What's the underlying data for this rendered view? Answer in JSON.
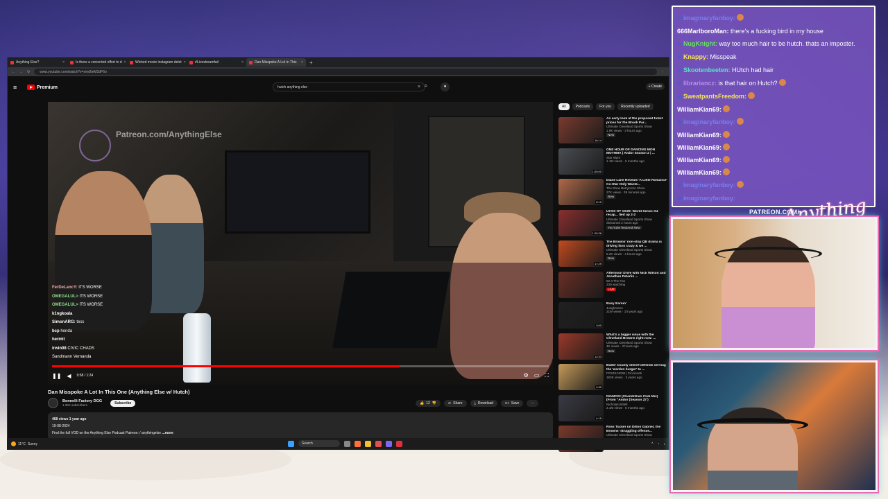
{
  "browser": {
    "tabs": [
      {
        "label": "Anything Else?",
        "active": false
      },
      {
        "label": "Is there a concerted effort to d",
        "active": false
      },
      {
        "label": "Wicked movie instagram delet",
        "active": false
      },
      {
        "label": "r/Livestreamfail",
        "active": false
      },
      {
        "label": "Dan Misspoke A Lot In This",
        "active": true
      }
    ],
    "url": "www.youtube.com/watch?v=xmd0eM3dF6o"
  },
  "youtube": {
    "logo": "Premium",
    "search_value": "hutch anything else",
    "create_label": "+ Create",
    "video": {
      "watermark": "Patreon.com/AnythingElse",
      "overlay_chat": [
        {
          "user": "FerDeLancY:",
          "msg": "ITS WORSE",
          "color": "#f0a8a8"
        },
        {
          "user": "OMEGALUL>",
          "msg": "ITS WORSE",
          "color": "#8fe08f"
        },
        {
          "user": "OMEGALUL>",
          "msg": "ITS WORSE",
          "color": "#8fe08f"
        },
        {
          "user": "k1ngkoala",
          "msg": "",
          "color": "#ffffff"
        },
        {
          "user": "SimonARG:",
          "msg": "tess",
          "color": "#ffffff"
        },
        {
          "user": "bcp",
          "msg": "honda",
          "color": "#ffffff"
        },
        {
          "user": "hermit",
          "msg": "",
          "color": "#ffffff"
        },
        {
          "user": "irwin08",
          "msg": "CIVIC CHADS",
          "color": "#ffffff"
        },
        {
          "user": "",
          "msg": "Sandmann Vernanda",
          "color": "#ffffff"
        }
      ],
      "time": "0:58 / 1:24",
      "progress": 0.7,
      "title": "Dan Misspoke A Lot In This One (Anything Else w/ Hutch)"
    },
    "channel": {
      "name": "Bonnelli Factory DGG",
      "subs": "1.36K subscribers",
      "subscribe_label": "Subscribe"
    },
    "actions": {
      "likes": "12",
      "share": "Share",
      "download": "Download",
      "save": "Save"
    },
    "description": {
      "stats": "468 views  1 year ago",
      "date": "19-08-2024",
      "text": "Find the full VOD on the Anything Else Podcast Patreon:  / anythingelse",
      "more": "...more"
    },
    "chips": [
      "All",
      "Podcasts",
      "For you",
      "Recently uploaded"
    ],
    "recs": [
      {
        "title": "An early look at the proposed ticket prices for the Brook Par...",
        "channel": "Ultimate Cleveland Sports Show",
        "meta": "1.9K views · 3 hours ago",
        "badge": "New",
        "dur": "16:14",
        "thumb": "#7a3b2f"
      },
      {
        "title": "ONE HOUR OF DANCING MON MOTHMA | Andor Season 2 | ...",
        "channel": "Star Wars",
        "meta": "1.1M views · 6 months ago",
        "badge": "",
        "dur": "1:00:00",
        "thumb": "#4a4e52"
      },
      {
        "title": "Diane Lane Reveals 'A Little Romance' Co-Star Only Wante...",
        "channel": "The Drew Barrymore Show",
        "meta": "27K views · 39 minutes ago",
        "badge": "New",
        "dur": "5:19",
        "thumb": "#b06a4a"
      },
      {
        "title": "UCSS OT 10/29: World Series G4 recap... tied up 2-2",
        "channel": "Ultimate Cleveland Sports Show",
        "meta": "Streamed 2 hours ago",
        "badge": "YouTube featured  New",
        "dur": "1:29:28",
        "thumb": "#8a2f2f"
      },
      {
        "title": "The Browns' non-stop QB drama is driving fans crazy & we ...",
        "channel": "Ultimate Cleveland Sports Show",
        "meta": "5.2K views · 4 hours ago",
        "badge": "New",
        "dur": "17:29",
        "thumb": "#c14a20"
      },
      {
        "title": "Afternoon Drive with Nick Wilson and Jonathan Peterlin ...",
        "channel": "92.3 The Fan",
        "meta": "239 watching",
        "badge": "LIVE",
        "dur": "",
        "thumb": "#6b2f26"
      },
      {
        "title": "Busy Earnin'",
        "channel": "JungleVevo",
        "meta": "21M views · 10 years ago",
        "badge": "",
        "dur": "3:00",
        "thumb": "#202020"
      },
      {
        "title": "What's a bigger issue with the Cleveland Browns right now: ...",
        "channel": "Ultimate Cleveland Sports Show",
        "meta": "4K views · 3 hours ago",
        "badge": "New",
        "dur": "12:33",
        "thumb": "#9a3a2a"
      },
      {
        "title": "Butler County sheriff defends serving the 'warden burger' to ...",
        "channel": "FOX19 NOW | Cincinnati",
        "meta": "163K views · 3 years ago",
        "badge": "",
        "dur": "4:32",
        "thumb": "#c59a5a"
      },
      {
        "title": "NIAMOS! (Chandrillian Club Mix) (From \"Andor (Season 2)\")",
        "channel": "Nicholas Britell",
        "meta": "2.1M views · 6 months ago",
        "badge": "",
        "dur": "4:15",
        "thumb": "#3a3a44"
      },
      {
        "title": "Ross Tucker on Dillon Gabriel, the Browns' struggling offense...",
        "channel": "Ultimate Cleveland Sports Show",
        "meta": "3.7K views · 3 hours ago",
        "badge": "New",
        "dur": "22:44",
        "thumb": "#7b3a2c"
      }
    ]
  },
  "taskbar": {
    "temp": "11°C",
    "weather": "Sunny",
    "search": "Search"
  },
  "stream_chat": [
    {
      "user": "imaginaryfanboy:",
      "msg": "",
      "color": "#7a7ff0",
      "badge": true,
      "emote": true
    },
    {
      "user": "666MarlboroMan:",
      "msg": "there's a fucking bird in my house",
      "color": "#ffffff",
      "badge": false,
      "emote": false
    },
    {
      "user": "NugKnight:",
      "msg": "way too much hair to be hutch. thats an imposter.",
      "color": "#65e35c",
      "badge": true,
      "emote": false
    },
    {
      "user": "Knappy:",
      "msg": "Misspeak",
      "color": "#f7e55a",
      "badge": true,
      "emote": false
    },
    {
      "user": "Skootenbeeten:",
      "msg": "HUtch had hair",
      "color": "#5fe0c8",
      "badge": true,
      "emote": false
    },
    {
      "user": "librariancz:",
      "msg": "is that hair on Hutch?",
      "color": "#b98bf0",
      "badge": true,
      "emote": true
    },
    {
      "user": "SweatpantsFreedom:",
      "msg": "",
      "color": "#f7e55a",
      "badge": true,
      "emote": true
    },
    {
      "user": "WilliamKian69:",
      "msg": "",
      "color": "#ffffff",
      "badge": false,
      "emote": true
    },
    {
      "user": "imaginaryfanboy:",
      "msg": "",
      "color": "#7a7ff0",
      "badge": true,
      "emote": true
    },
    {
      "user": "WilliamKian69:",
      "msg": "",
      "color": "#ffffff",
      "badge": false,
      "emote": true
    },
    {
      "user": "WilliamKian69:",
      "msg": "",
      "color": "#ffffff",
      "badge": false,
      "emote": true
    },
    {
      "user": "WilliamKian69:",
      "msg": "",
      "color": "#ffffff",
      "badge": false,
      "emote": true
    },
    {
      "user": "WilliamKian69:",
      "msg": "",
      "color": "#ffffff",
      "badge": false,
      "emote": true
    },
    {
      "user": "imaginaryfanboy:",
      "msg": "",
      "color": "#7a7ff0",
      "badge": true,
      "emote": true
    },
    {
      "user": "imaginaryfanboy:",
      "msg": "",
      "color": "#7a7ff0",
      "badge": true,
      "emote": false
    }
  ],
  "branding": {
    "patreon": "PATREON.COM/",
    "logo": "Anything else"
  }
}
